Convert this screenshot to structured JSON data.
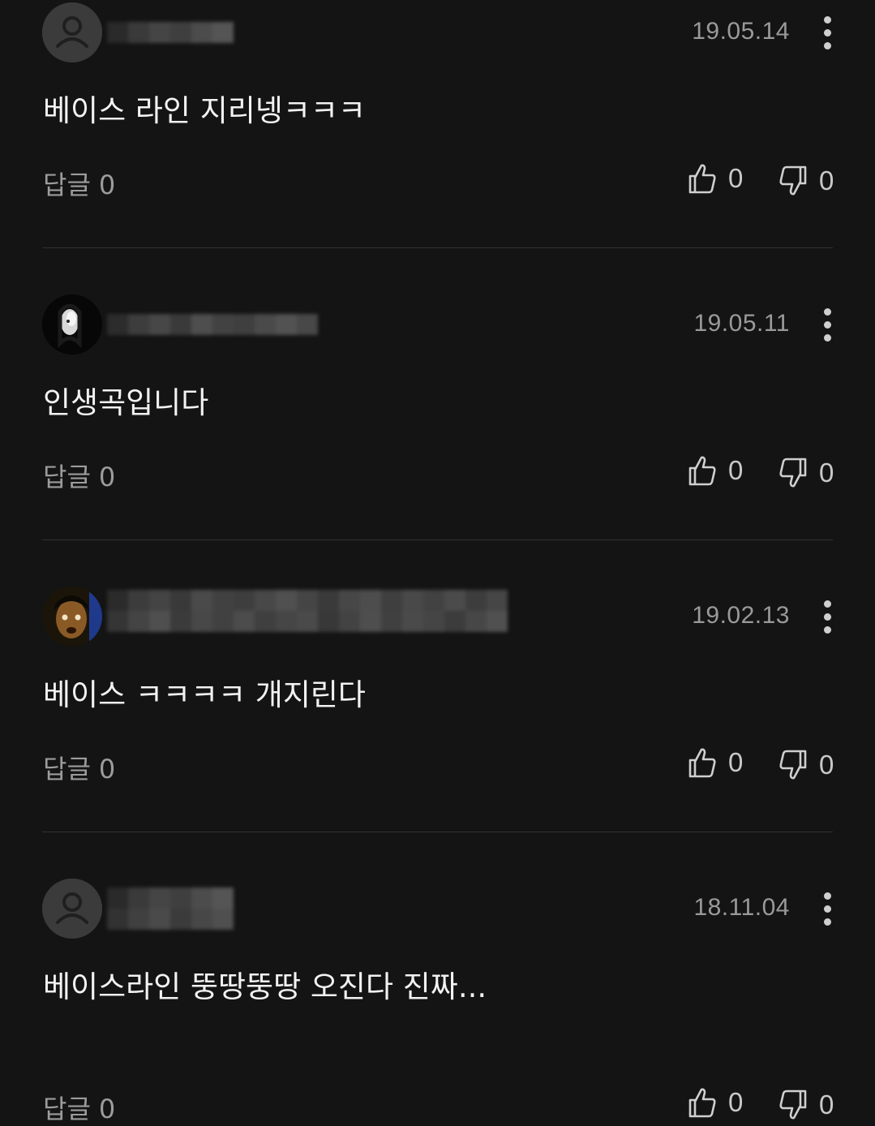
{
  "comments": [
    {
      "avatar_icon": "default-person-icon",
      "date": "19.05.14",
      "text": "베이스 라인 지리넹ㅋㅋㅋ",
      "reply_label": "답글",
      "reply_count": "0",
      "likes": "0",
      "dislikes": "0"
    },
    {
      "avatar_icon": "profile-photo",
      "date": "19.05.11",
      "text": "인생곡입니다",
      "reply_label": "답글",
      "reply_count": "0",
      "likes": "0",
      "dislikes": "0"
    },
    {
      "avatar_icon": "profile-photo",
      "date": "19.02.13",
      "text": "베이스 ㅋㅋㅋㅋ 개지린다",
      "reply_label": "답글",
      "reply_count": "0",
      "likes": "0",
      "dislikes": "0"
    },
    {
      "avatar_icon": "default-person-icon",
      "date": "18.11.04",
      "text": "베이스라인 뚱땅뚱땅 오진다 진짜...",
      "reply_label": "답글",
      "reply_count": "0",
      "likes": "0",
      "dislikes": "0"
    }
  ],
  "colors": {
    "background": "#141414",
    "text": "#f2f2f2",
    "muted": "#9c9c9c",
    "divider": "#333333"
  }
}
